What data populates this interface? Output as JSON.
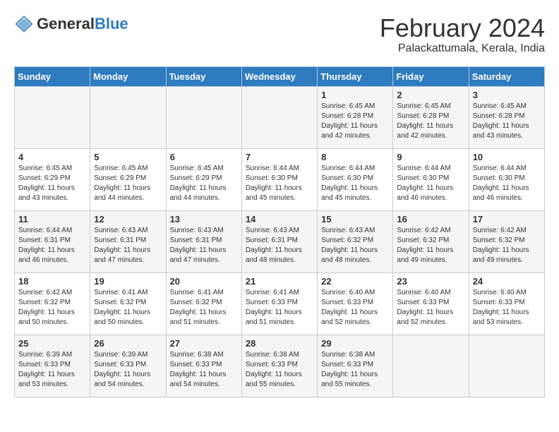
{
  "logo": {
    "text_general": "General",
    "text_blue": "Blue"
  },
  "title": "February 2024",
  "subtitle": "Palackattumala, Kerala, India",
  "days_of_week": [
    "Sunday",
    "Monday",
    "Tuesday",
    "Wednesday",
    "Thursday",
    "Friday",
    "Saturday"
  ],
  "weeks": [
    [
      {
        "day": "",
        "info": ""
      },
      {
        "day": "",
        "info": ""
      },
      {
        "day": "",
        "info": ""
      },
      {
        "day": "",
        "info": ""
      },
      {
        "day": "1",
        "info": "Sunrise: 6:45 AM\nSunset: 6:28 PM\nDaylight: 11 hours\nand 42 minutes."
      },
      {
        "day": "2",
        "info": "Sunrise: 6:45 AM\nSunset: 6:28 PM\nDaylight: 11 hours\nand 42 minutes."
      },
      {
        "day": "3",
        "info": "Sunrise: 6:45 AM\nSunset: 6:28 PM\nDaylight: 11 hours\nand 43 minutes."
      }
    ],
    [
      {
        "day": "4",
        "info": "Sunrise: 6:45 AM\nSunset: 6:29 PM\nDaylight: 11 hours\nand 43 minutes."
      },
      {
        "day": "5",
        "info": "Sunrise: 6:45 AM\nSunset: 6:29 PM\nDaylight: 11 hours\nand 44 minutes."
      },
      {
        "day": "6",
        "info": "Sunrise: 6:45 AM\nSunset: 6:29 PM\nDaylight: 11 hours\nand 44 minutes."
      },
      {
        "day": "7",
        "info": "Sunrise: 6:44 AM\nSunset: 6:30 PM\nDaylight: 11 hours\nand 45 minutes."
      },
      {
        "day": "8",
        "info": "Sunrise: 6:44 AM\nSunset: 6:30 PM\nDaylight: 11 hours\nand 45 minutes."
      },
      {
        "day": "9",
        "info": "Sunrise: 6:44 AM\nSunset: 6:30 PM\nDaylight: 11 hours\nand 46 minutes."
      },
      {
        "day": "10",
        "info": "Sunrise: 6:44 AM\nSunset: 6:30 PM\nDaylight: 11 hours\nand 46 minutes."
      }
    ],
    [
      {
        "day": "11",
        "info": "Sunrise: 6:44 AM\nSunset: 6:31 PM\nDaylight: 11 hours\nand 46 minutes."
      },
      {
        "day": "12",
        "info": "Sunrise: 6:43 AM\nSunset: 6:31 PM\nDaylight: 11 hours\nand 47 minutes."
      },
      {
        "day": "13",
        "info": "Sunrise: 6:43 AM\nSunset: 6:31 PM\nDaylight: 11 hours\nand 47 minutes."
      },
      {
        "day": "14",
        "info": "Sunrise: 6:43 AM\nSunset: 6:31 PM\nDaylight: 11 hours\nand 48 minutes."
      },
      {
        "day": "15",
        "info": "Sunrise: 6:43 AM\nSunset: 6:32 PM\nDaylight: 11 hours\nand 48 minutes."
      },
      {
        "day": "16",
        "info": "Sunrise: 6:42 AM\nSunset: 6:32 PM\nDaylight: 11 hours\nand 49 minutes."
      },
      {
        "day": "17",
        "info": "Sunrise: 6:42 AM\nSunset: 6:32 PM\nDaylight: 11 hours\nand 49 minutes."
      }
    ],
    [
      {
        "day": "18",
        "info": "Sunrise: 6:42 AM\nSunset: 6:32 PM\nDaylight: 11 hours\nand 50 minutes."
      },
      {
        "day": "19",
        "info": "Sunrise: 6:41 AM\nSunset: 6:32 PM\nDaylight: 11 hours\nand 50 minutes."
      },
      {
        "day": "20",
        "info": "Sunrise: 6:41 AM\nSunset: 6:32 PM\nDaylight: 11 hours\nand 51 minutes."
      },
      {
        "day": "21",
        "info": "Sunrise: 6:41 AM\nSunset: 6:33 PM\nDaylight: 11 hours\nand 51 minutes."
      },
      {
        "day": "22",
        "info": "Sunrise: 6:40 AM\nSunset: 6:33 PM\nDaylight: 11 hours\nand 52 minutes."
      },
      {
        "day": "23",
        "info": "Sunrise: 6:40 AM\nSunset: 6:33 PM\nDaylight: 11 hours\nand 52 minutes."
      },
      {
        "day": "24",
        "info": "Sunrise: 6:40 AM\nSunset: 6:33 PM\nDaylight: 11 hours\nand 53 minutes."
      }
    ],
    [
      {
        "day": "25",
        "info": "Sunrise: 6:39 AM\nSunset: 6:33 PM\nDaylight: 11 hours\nand 53 minutes."
      },
      {
        "day": "26",
        "info": "Sunrise: 6:39 AM\nSunset: 6:33 PM\nDaylight: 11 hours\nand 54 minutes."
      },
      {
        "day": "27",
        "info": "Sunrise: 6:38 AM\nSunset: 6:33 PM\nDaylight: 11 hours\nand 54 minutes."
      },
      {
        "day": "28",
        "info": "Sunrise: 6:38 AM\nSunset: 6:33 PM\nDaylight: 11 hours\nand 55 minutes."
      },
      {
        "day": "29",
        "info": "Sunrise: 6:38 AM\nSunset: 6:33 PM\nDaylight: 11 hours\nand 55 minutes."
      },
      {
        "day": "",
        "info": ""
      },
      {
        "day": "",
        "info": ""
      }
    ]
  ]
}
